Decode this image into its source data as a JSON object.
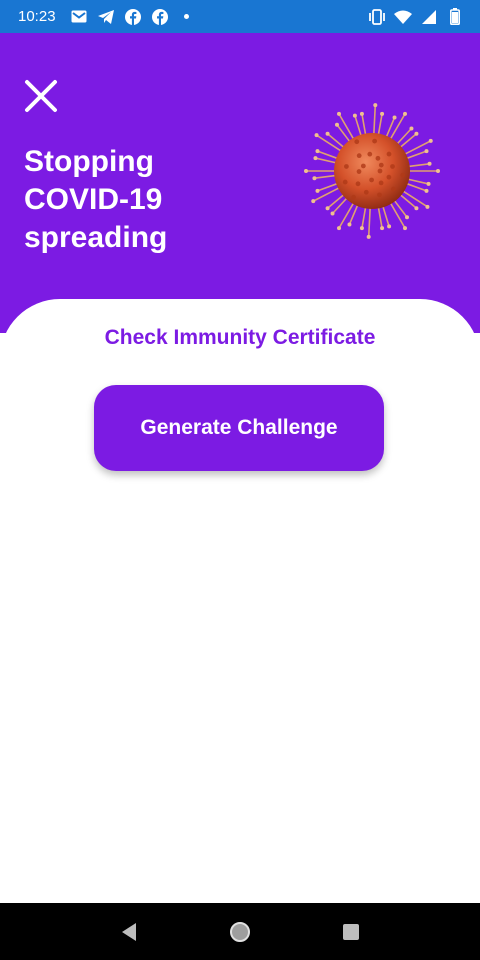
{
  "status_bar": {
    "time": "10:23",
    "left_icons": [
      "gmail-icon",
      "telegram-icon",
      "facebook-icon",
      "facebook-icon",
      "notification-dot"
    ],
    "right_icons": [
      "vibrate-icon",
      "wifi-icon",
      "signal-icon",
      "battery-icon"
    ],
    "color": "#1976D2"
  },
  "header": {
    "title": "Stopping COVID-19 spreading",
    "close_icon": "close-icon",
    "image": "coronavirus-illustration",
    "color": "#7C1BE3"
  },
  "main": {
    "section_title": "Check Immunity Certificate",
    "generate_button_label": "Generate Challenge",
    "accent_color": "#7C1BE3"
  },
  "nav_bar": {
    "buttons": [
      "back-icon",
      "home-icon",
      "recents-icon"
    ]
  }
}
